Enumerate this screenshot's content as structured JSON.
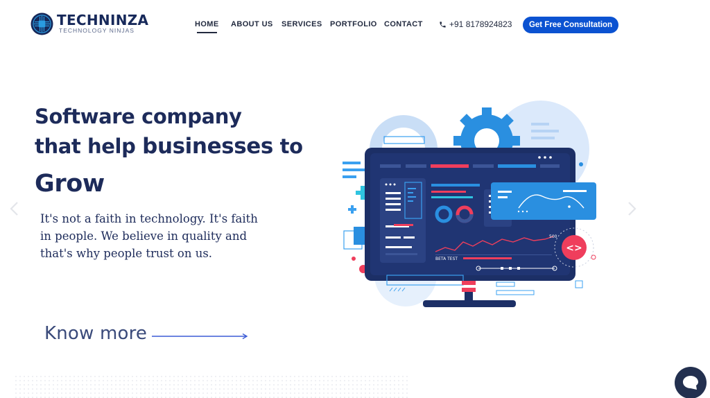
{
  "brand": {
    "name": "TECHNINZA",
    "tagline": "TECHNOLOGY NINJAS"
  },
  "nav": {
    "items": [
      {
        "label": "HOME",
        "active": true
      },
      {
        "label": "ABOUT US",
        "active": false
      },
      {
        "label": "SERVICES",
        "active": false
      },
      {
        "label": "PORTFOLIO",
        "active": false
      },
      {
        "label": "CONTACT",
        "active": false
      }
    ],
    "phone": "+91 8178924823",
    "phone_icon": "phone-icon",
    "cta_label": "Get Free Consultation"
  },
  "hero": {
    "line1": "Software company",
    "line2_a": "that help ",
    "line2_b": "businesses",
    "line2_c": " to",
    "line3": "Grow",
    "paragraph": "It's not a faith in technology. It's faith in people. We believe in quality and that's why people trust on us.",
    "know_more": "Know more"
  },
  "illustration": {
    "beta_label": "BETA TEST",
    "graph_label": "500",
    "code_badge": "<>"
  },
  "colors": {
    "primary": "#0b52d1",
    "navy": "#1d2b5a",
    "accent_red": "#ef3e5c",
    "accent_blue": "#3aa0f0"
  }
}
